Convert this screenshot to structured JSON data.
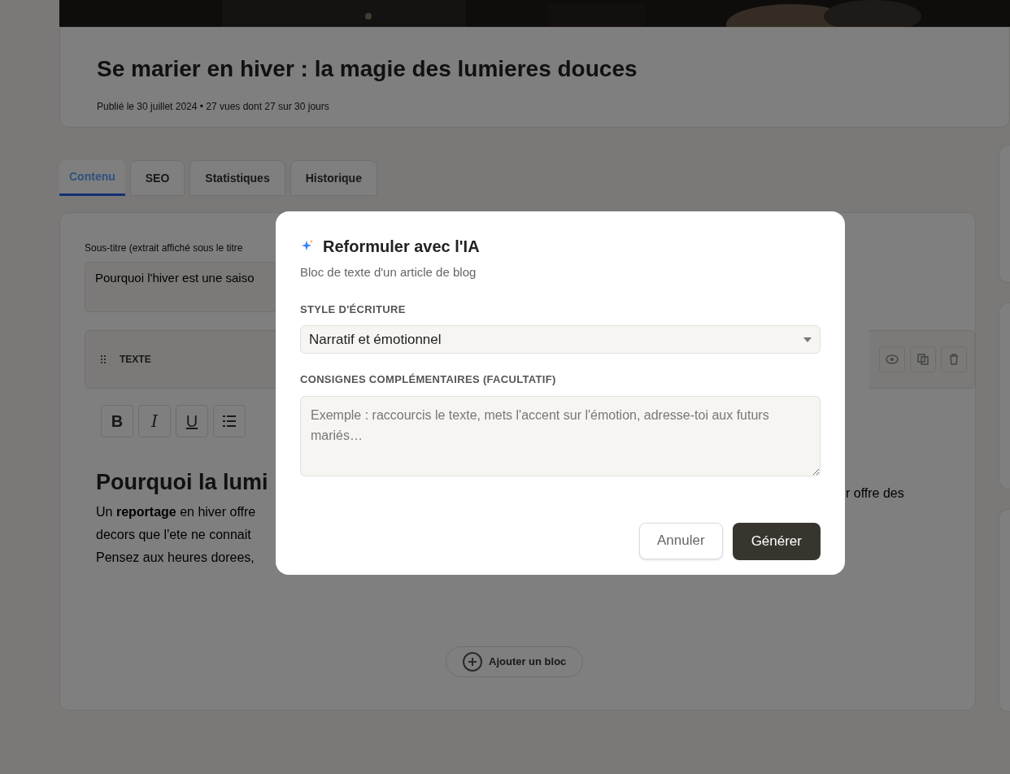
{
  "article": {
    "title": "Se marier en hiver : la magie des lumieres douces",
    "meta": "Publié le 30 juillet 2024 • 27 vues dont 27 sur 30 jours"
  },
  "tabs": [
    {
      "label": "Contenu",
      "selected": true
    },
    {
      "label": "SEO",
      "selected": false
    },
    {
      "label": "Statistiques",
      "selected": false
    },
    {
      "label": "Historique",
      "selected": false
    }
  ],
  "editor": {
    "subtitle_label": "Sous-titre (extrait affiché sous le titre",
    "subtitle_value": "Pourquoi l'hiver est une saiso",
    "block_label": "TEXTE",
    "toolbar": [
      "B",
      "I",
      "U"
    ],
    "heading": "Pourquoi la lumi",
    "lines": [
      {
        "left": "Un **reportage** en hiver offre",
        "right": "r offre des"
      },
      {
        "left": "decors que l'ete ne connait"
      },
      {
        "left": "Pensez aux heures dorees,"
      }
    ],
    "add_block": "Ajouter un bloc"
  },
  "modal": {
    "title": "Reformuler avec l'IA",
    "subtitle": "Bloc de texte d'un article de blog",
    "style_label": "STYLE D'ÉCRITURE",
    "style_value": "Narratif et émotionnel",
    "instructions_label": "CONSIGNES COMPLÉMENTAIRES (FACULTATIF)",
    "instructions_placeholder": "Exemple : raccourcis le texte, mets l'accent sur l'émotion, adresse-toi aux futurs mariés…",
    "buttons": [
      {
        "label": "Annuler",
        "kind": "secondary"
      },
      {
        "label": "Générer",
        "kind": "primary"
      }
    ]
  }
}
